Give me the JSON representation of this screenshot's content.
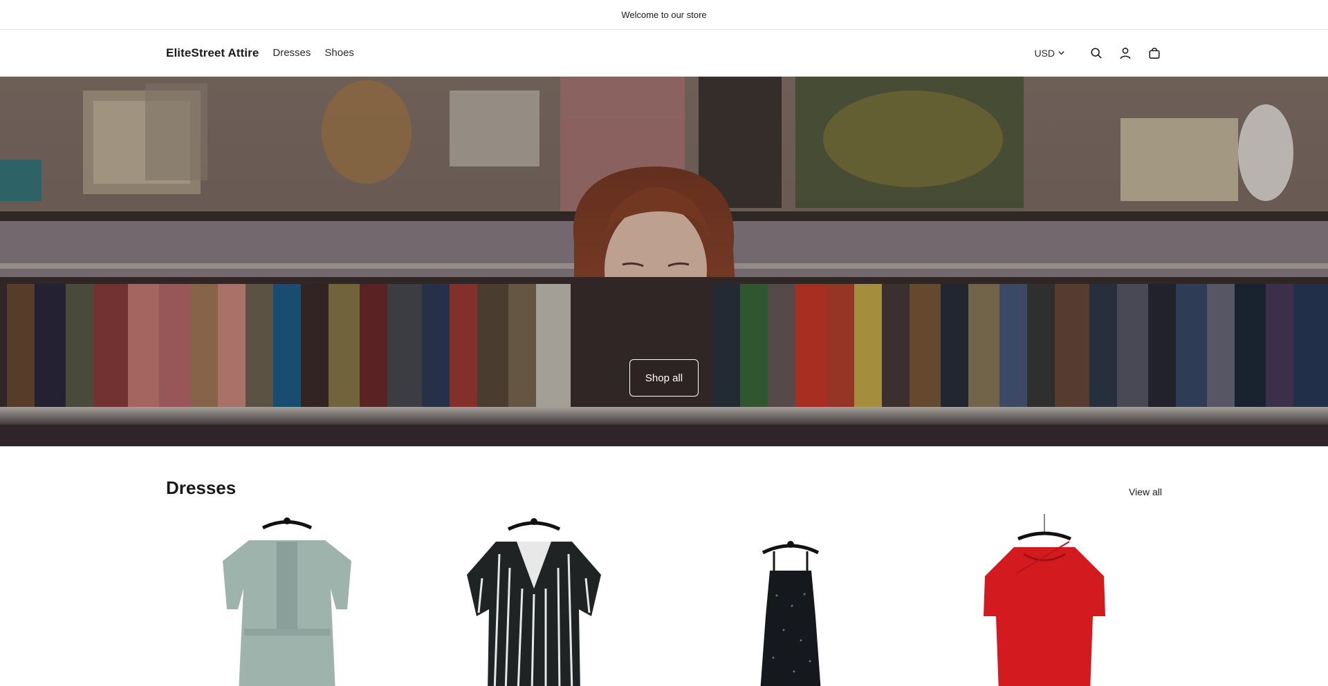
{
  "announcement": {
    "text": "Welcome to our store"
  },
  "header": {
    "logo": "EliteStreet Attire",
    "nav": [
      {
        "label": "Dresses"
      },
      {
        "label": "Shoes"
      }
    ],
    "currency": "USD",
    "icons": [
      "search-icon",
      "account-icon",
      "cart-icon"
    ]
  },
  "hero": {
    "button_label": "Shop all"
  },
  "collection": {
    "title": "Dresses",
    "view_all": "View all",
    "products": [
      {
        "color": "#9fb3ad"
      },
      {
        "color": "#1f2324"
      },
      {
        "color": "#15181c"
      },
      {
        "color": "#d21a1f"
      }
    ]
  }
}
